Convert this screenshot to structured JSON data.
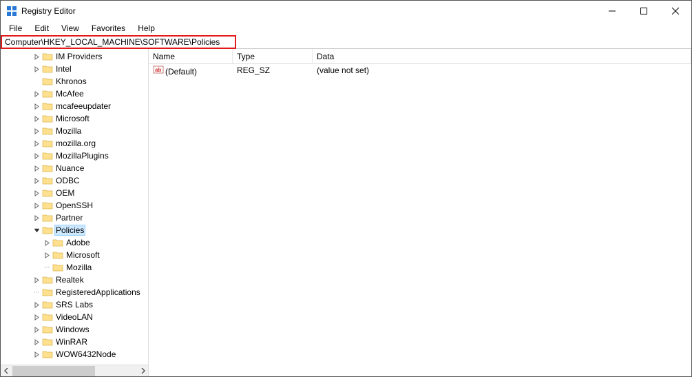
{
  "window": {
    "title": "Registry Editor"
  },
  "menu": {
    "file": "File",
    "edit": "Edit",
    "view": "View",
    "favorites": "Favorites",
    "help": "Help"
  },
  "address": {
    "path": "Computer\\HKEY_LOCAL_MACHINE\\SOFTWARE\\Policies"
  },
  "tree": {
    "items": [
      {
        "indent": 3,
        "twisty": "r",
        "label": "IM Providers"
      },
      {
        "indent": 3,
        "twisty": "r",
        "label": "Intel"
      },
      {
        "indent": 3,
        "twisty": "",
        "label": "Khronos"
      },
      {
        "indent": 3,
        "twisty": "r",
        "label": "McAfee"
      },
      {
        "indent": 3,
        "twisty": "r",
        "label": "mcafeeupdater"
      },
      {
        "indent": 3,
        "twisty": "r",
        "label": "Microsoft"
      },
      {
        "indent": 3,
        "twisty": "r",
        "label": "Mozilla"
      },
      {
        "indent": 3,
        "twisty": "r",
        "label": "mozilla.org"
      },
      {
        "indent": 3,
        "twisty": "r",
        "label": "MozillaPlugins"
      },
      {
        "indent": 3,
        "twisty": "r",
        "label": "Nuance"
      },
      {
        "indent": 3,
        "twisty": "r",
        "label": "ODBC"
      },
      {
        "indent": 3,
        "twisty": "r",
        "label": "OEM"
      },
      {
        "indent": 3,
        "twisty": "r",
        "label": "OpenSSH"
      },
      {
        "indent": 3,
        "twisty": "r",
        "label": "Partner"
      },
      {
        "indent": 3,
        "twisty": "d",
        "label": "Policies",
        "selected": true
      },
      {
        "indent": 4,
        "twisty": "r",
        "label": "Adobe"
      },
      {
        "indent": 4,
        "twisty": "r",
        "label": "Microsoft"
      },
      {
        "indent": 4,
        "twisty": "",
        "label": "Mozilla",
        "dot": true
      },
      {
        "indent": 3,
        "twisty": "r",
        "label": "Realtek"
      },
      {
        "indent": 3,
        "twisty": "",
        "label": "RegisteredApplications",
        "dot": true
      },
      {
        "indent": 3,
        "twisty": "r",
        "label": "SRS Labs"
      },
      {
        "indent": 3,
        "twisty": "r",
        "label": "VideoLAN"
      },
      {
        "indent": 3,
        "twisty": "r",
        "label": "Windows"
      },
      {
        "indent": 3,
        "twisty": "r",
        "label": "WinRAR"
      },
      {
        "indent": 3,
        "twisty": "r",
        "label": "WOW6432Node"
      }
    ]
  },
  "list": {
    "headers": {
      "name": "Name",
      "type": "Type",
      "data": "Data"
    },
    "rows": [
      {
        "name": "(Default)",
        "type": "REG_SZ",
        "data": "(value not set)"
      }
    ]
  }
}
